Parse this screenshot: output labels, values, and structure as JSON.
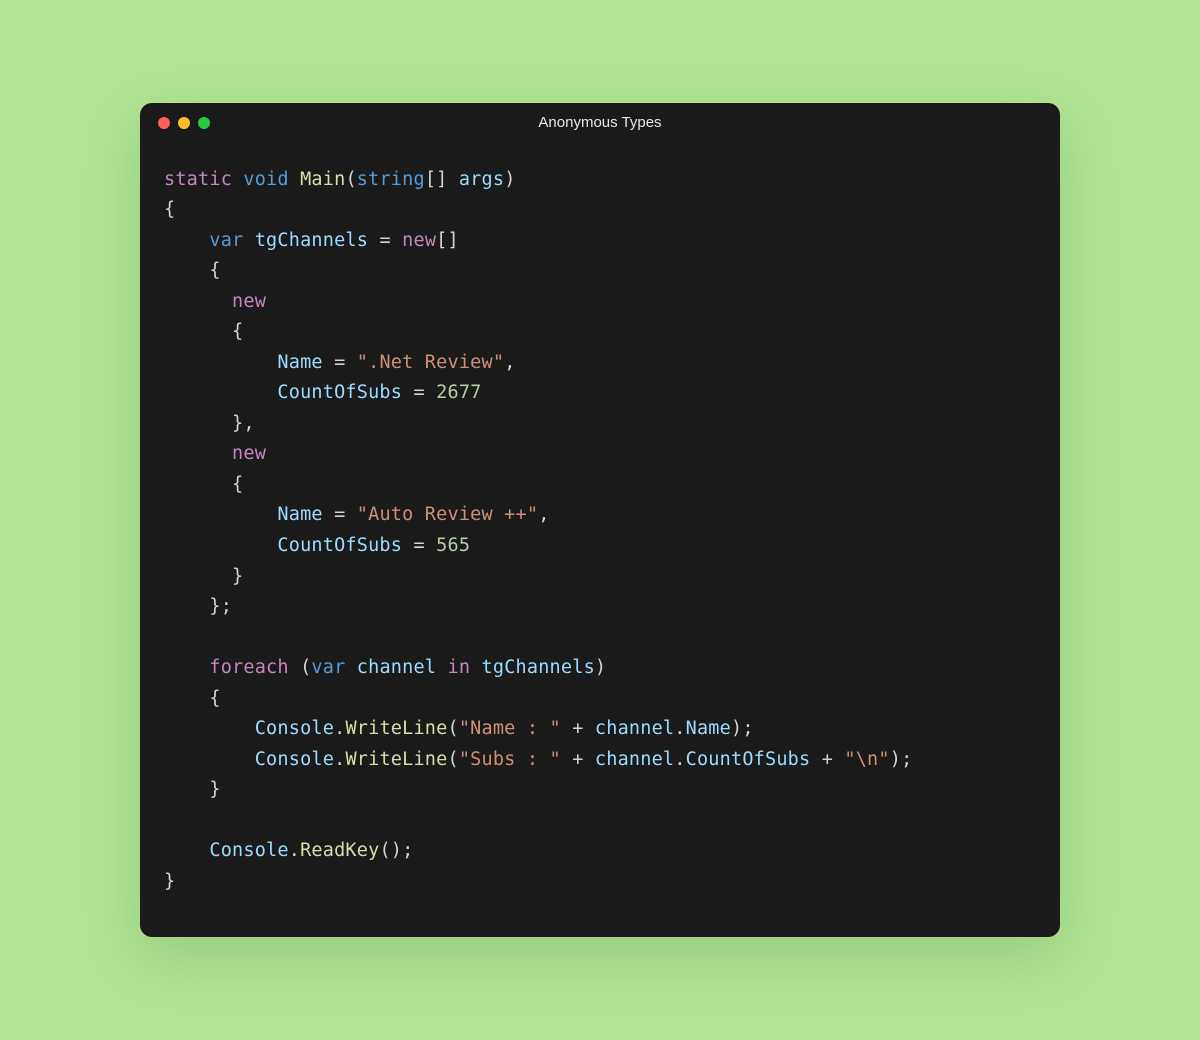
{
  "window": {
    "title": "Anonymous Types"
  },
  "code": {
    "kw_static": "static",
    "kw_void": "void",
    "fn_main": "Main",
    "type_string": "string",
    "var_args": "args",
    "kw_var1": "var",
    "var_tgChannels": "tgChannels",
    "kw_new_arr": "new",
    "kw_new1": "new",
    "prop_name1": "Name",
    "val_name1": "\".Net Review\"",
    "prop_count1": "CountOfSubs",
    "val_count1": "2677",
    "kw_new2": "new",
    "prop_name2": "Name",
    "val_name2": "\"Auto Review ++\"",
    "prop_count2": "CountOfSubs",
    "val_count2": "565",
    "kw_foreach": "foreach",
    "kw_var2": "var",
    "var_channel": "channel",
    "kw_in": "in",
    "var_tgChannels2": "tgChannels",
    "cls_console1": "Console",
    "fn_writeline1": "WriteLine",
    "str_name": "\"Name : \"",
    "var_channel_name": "channel",
    "prop_access_name": "Name",
    "cls_console2": "Console",
    "fn_writeline2": "WriteLine",
    "str_subs": "\"Subs : \"",
    "var_channel_subs": "channel",
    "prop_access_subs": "CountOfSubs",
    "str_nl": "\"\\n\"",
    "cls_console3": "Console",
    "fn_readkey": "ReadKey"
  }
}
